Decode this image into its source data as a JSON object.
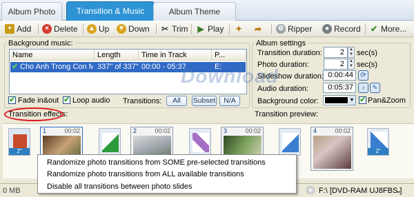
{
  "tabs": [
    "Album Photo",
    "Transition & Music",
    "Album Theme"
  ],
  "toolbar": {
    "add": "Add",
    "delete": "Delete",
    "up": "Up",
    "down": "Down",
    "trim": "Trim",
    "play": "Play",
    "ripper": "Ripper",
    "record": "Record",
    "more": "More..."
  },
  "music": {
    "title": "Background music:",
    "columns": [
      "Name",
      "Length",
      "Time in Track",
      "P..."
    ],
    "row": {
      "name": "Cho Anh Trong Con Mu...",
      "length": "337\" of 337\"",
      "time": "00:00 - 05:37",
      "p": "E:"
    },
    "fade": "Fade in&out",
    "loop": "Loop audio",
    "transitions_label": "Transitions:",
    "btn_all": "All",
    "btn_subset": "Subset",
    "btn_na": "N/A"
  },
  "album": {
    "title": "Album settings",
    "transition_duration_label": "Transition duration:",
    "transition_duration": "2",
    "photo_duration_label": "Photo duration:",
    "photo_duration": "2",
    "unit": "sec(s)",
    "slideshow_label": "Slideshow duration:",
    "slideshow": "0:00:44",
    "audio_label": "Audio duration:",
    "audio": "0:05:37",
    "bg_label": "Background color:",
    "panzoom": "Pan&Zoom"
  },
  "effects_label": "Transition effects:",
  "preview_label": "Transition preview:",
  "watermark": "Download",
  "frames": [
    {
      "num": "1",
      "dur": "00:02"
    },
    {
      "num": "2",
      "dur": "00:02"
    },
    {
      "num": "3",
      "dur": "00:02"
    },
    {
      "num": "4",
      "dur": "00:02"
    }
  ],
  "tr_dur": "2\"",
  "menu": {
    "item1": "Randomize photo transitions from SOME pre-selected transitions",
    "item2": "Randomize photo transitions from ALL available transitions",
    "item3": "Disable all transitions between photo slides"
  },
  "status": {
    "left": "0 MB",
    "drive": "F:\\ [DVD-RAM UJ8FBS ]"
  },
  "colors": {
    "tab_active": "#2d93d4",
    "selection": "#316ac5",
    "highlight_circle": "#e0141b"
  }
}
